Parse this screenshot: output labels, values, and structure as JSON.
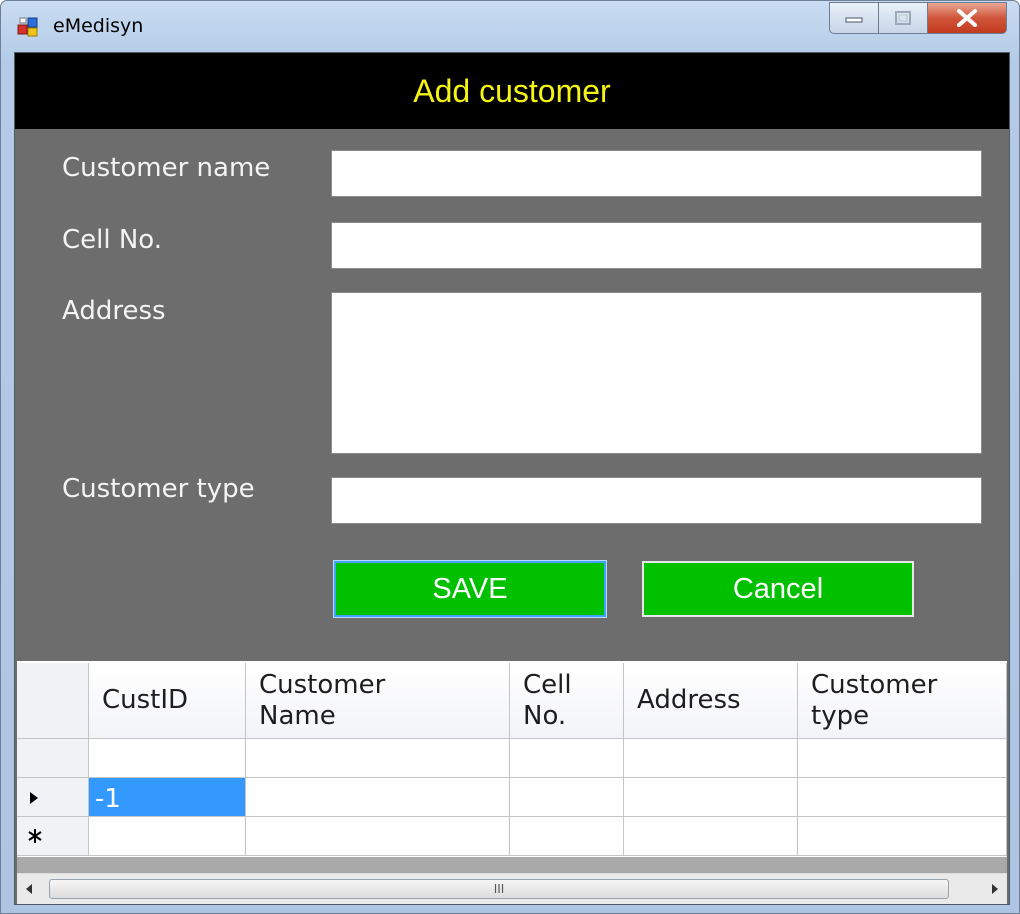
{
  "window": {
    "title": "eMedisyn"
  },
  "form": {
    "heading": "Add customer",
    "labels": {
      "customer_name": "Customer name",
      "cell_no": "Cell No.",
      "address": "Address",
      "customer_type": "Customer type"
    },
    "values": {
      "customer_name": "",
      "cell_no": "",
      "address": "",
      "customer_type": ""
    },
    "buttons": {
      "save": "SAVE",
      "cancel": "Cancel"
    }
  },
  "grid": {
    "columns": [
      {
        "line1": "CustID",
        "line2": ""
      },
      {
        "line1": "Customer",
        "line2": "Name"
      },
      {
        "line1": "Cell",
        "line2": "No."
      },
      {
        "line1": "Address",
        "line2": ""
      },
      {
        "line1": "Customer",
        "line2": "type"
      }
    ],
    "rows": [
      {
        "marker": "",
        "cells": [
          "",
          "",
          "",
          "",
          ""
        ]
      },
      {
        "marker": "current-row",
        "cells": [
          "-1",
          "",
          "",
          "",
          ""
        ]
      },
      {
        "marker": "new-row",
        "cells": [
          "",
          "",
          "",
          "",
          ""
        ]
      }
    ],
    "scroll_grip": "III"
  },
  "colors": {
    "heading_text": "#f4f414",
    "button_bg": "#00c000",
    "form_bg": "#6d6d6d",
    "selected_cell": "#3399ff"
  },
  "icons": [
    "app-icon",
    "minimize-icon",
    "maximize-icon",
    "close-icon",
    "current-row-arrow-icon",
    "new-row-asterisk-icon",
    "scroll-left-arrow-icon",
    "scroll-right-arrow-icon"
  ]
}
